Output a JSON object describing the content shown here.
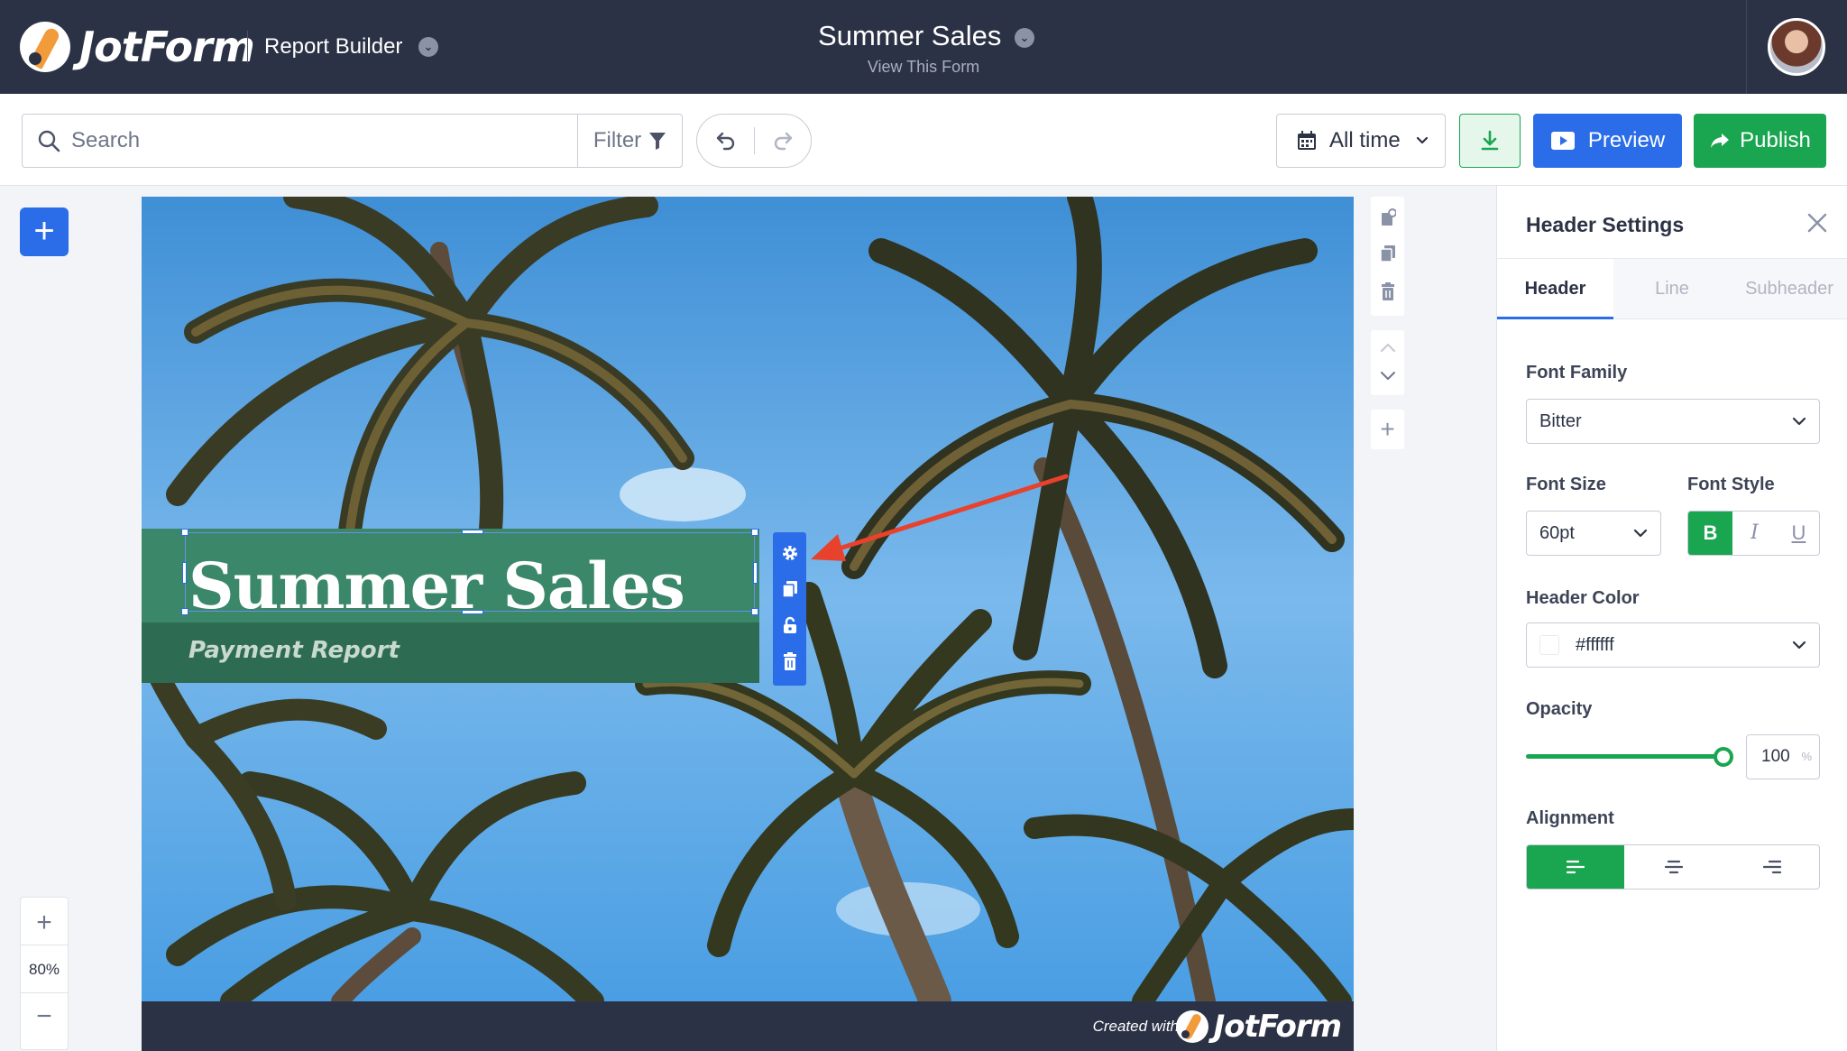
{
  "topbar": {
    "logo_text": "JotForm",
    "app_name": "Report Builder",
    "form_title": "Summer Sales",
    "form_subtitle": "View This Form"
  },
  "toolbar": {
    "search_placeholder": "Search",
    "filter_label": "Filter",
    "date_range": "All time",
    "preview_label": "Preview",
    "publish_label": "Publish"
  },
  "zoom": {
    "level": "80%",
    "in_symbol": "+",
    "out_symbol": "−"
  },
  "add_symbol": "+",
  "report": {
    "header": "Summer Sales",
    "subheader": "Payment Report",
    "footer_created": "Created with",
    "footer_logo": "JotForm"
  },
  "panel": {
    "title": "Header Settings",
    "tabs": [
      {
        "label": "Header",
        "active": true
      },
      {
        "label": "Line",
        "active": false
      },
      {
        "label": "Subheader",
        "active": false
      }
    ],
    "font_family_label": "Font Family",
    "font_family_value": "Bitter",
    "font_size_label": "Font Size",
    "font_size_value": "60pt",
    "font_style_label": "Font Style",
    "font_styles": {
      "bold": "B",
      "italic": "I",
      "underline": "U"
    },
    "header_color_label": "Header Color",
    "header_color_value": "#ffffff",
    "opacity_label": "Opacity",
    "opacity_value": "100",
    "opacity_unit": "%",
    "opacity_fraction": 1.0,
    "alignment_label": "Alignment",
    "alignment_selected": "left"
  },
  "colors": {
    "topbar": "#2b3245",
    "primary_blue": "#2b6de8",
    "success_green": "#1aa550",
    "header_bg": "#3a876a",
    "subheader_bg": "#2d6b52",
    "annotation_arrow": "#e8412c"
  },
  "icons": [
    "search-icon",
    "filter-icon",
    "undo-icon",
    "redo-icon",
    "calendar-icon",
    "chevron-down-icon",
    "download-icon",
    "play-icon",
    "share-arrow-icon",
    "gear-icon",
    "copy-icon",
    "lock-icon",
    "trash-icon",
    "chevron-up-icon",
    "close-icon",
    "plus-icon",
    "align-left-icon",
    "align-center-icon",
    "align-right-icon"
  ]
}
